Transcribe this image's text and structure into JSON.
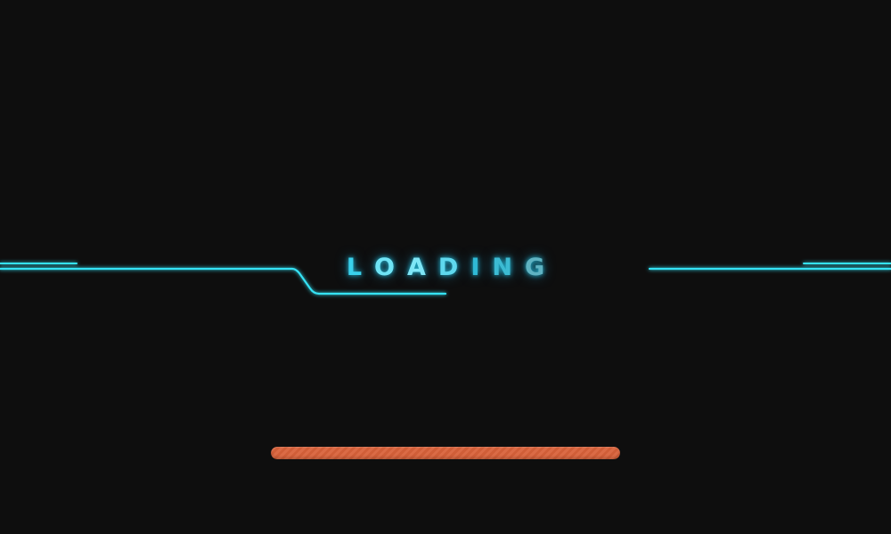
{
  "loading": {
    "text": "LOADING",
    "letter_colors": [
      "#3ad1ec",
      "#6fe4f5",
      "#7ee6f6",
      "#5fd9ee",
      "#2fb9d6",
      "#3cbbd3",
      "#5fb3c2"
    ]
  },
  "progress": {
    "fraction": 1.0,
    "color": "#d9623a"
  },
  "colors": {
    "background": "#0e0e0e",
    "neon": "#36e2f4",
    "neon_glow": "#1ad0ff"
  }
}
